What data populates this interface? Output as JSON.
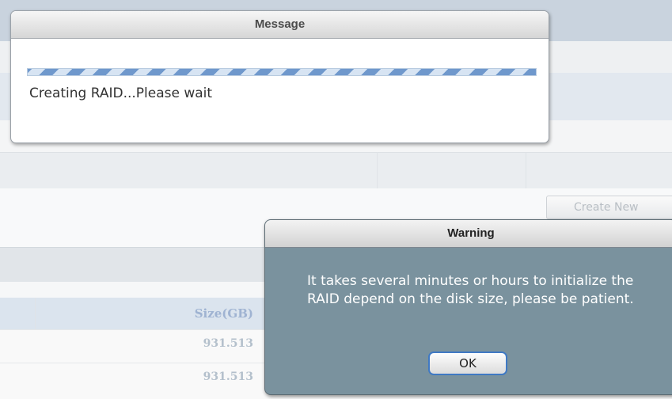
{
  "message_dialog": {
    "title": "Message",
    "progress_state": "indeterminate",
    "progress_colors": [
      "#6f98cc",
      "#d7e4f3"
    ],
    "text": "Creating RAID...Please wait"
  },
  "warning_dialog": {
    "title": "Warning",
    "text": "It takes several minutes or hours to initialize the RAID depend on the disk size, please be patient.",
    "ok_label": "OK",
    "body_color": "#7a929e",
    "button_border_color": "#3f79c4"
  },
  "background": {
    "create_button_label": "Create New",
    "table": {
      "size_header": "Size(GB)",
      "rows": [
        {
          "size": "931.513"
        },
        {
          "size": "931.513"
        }
      ]
    }
  }
}
